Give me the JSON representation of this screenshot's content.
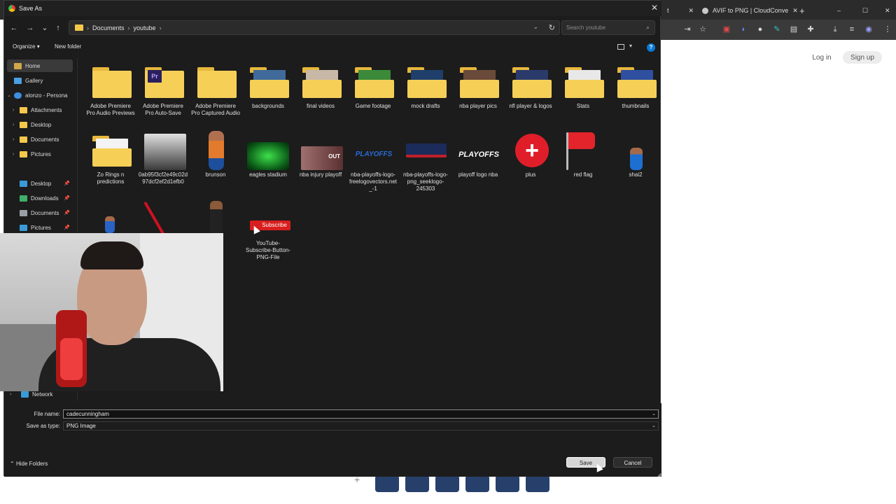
{
  "browser": {
    "tabs": [
      {
        "label": "t"
      },
      {
        "label": "AVIF to PNG | CloudConve"
      }
    ],
    "login": "Log in",
    "signup": "Sign up"
  },
  "dialog": {
    "title": "Save As",
    "breadcrumb": [
      "Documents",
      "youtube"
    ],
    "search_placeholder": "Search youtube",
    "organize": "Organize",
    "new_folder": "New folder",
    "sidebar": [
      {
        "label": "Home",
        "selected": true
      },
      {
        "label": "Gallery"
      },
      {
        "label": "alonzo - Persona"
      },
      {
        "label": "Attachments"
      },
      {
        "label": "Desktop"
      },
      {
        "label": "Documents"
      },
      {
        "label": "Pictures"
      },
      {
        "label": "Desktop",
        "pinned": true
      },
      {
        "label": "Downloads",
        "pinned": true
      },
      {
        "label": "Documents",
        "pinned": true
      },
      {
        "label": "Pictures",
        "pinned": true
      },
      {
        "label": "Network"
      }
    ],
    "items": [
      {
        "label": "Adobe Premiere Pro Audio Previews",
        "kind": "folder"
      },
      {
        "label": "Adobe Premiere Pro Auto-Save",
        "kind": "folder-pr"
      },
      {
        "label": "Adobe Premiere Pro Captured Audio",
        "kind": "folder"
      },
      {
        "label": "backgrounds",
        "kind": "folder-img"
      },
      {
        "label": "final videos",
        "kind": "folder-img"
      },
      {
        "label": "Game footage",
        "kind": "folder-img"
      },
      {
        "label": "mock drafts",
        "kind": "folder-img"
      },
      {
        "label": "nba player pics",
        "kind": "folder-img"
      },
      {
        "label": "nfl player & logos",
        "kind": "folder-img"
      },
      {
        "label": "Stats",
        "kind": "folder-img"
      },
      {
        "label": "thumbnails",
        "kind": "folder-img"
      },
      {
        "label": "Zo Rings n predictions",
        "kind": "folder"
      },
      {
        "label": "0ab95f3cf2e49c02d97dcf2ef2d1efb0",
        "kind": "image"
      },
      {
        "label": "brunson",
        "kind": "image"
      },
      {
        "label": "eagles stadium",
        "kind": "image"
      },
      {
        "label": "nba injury playoff",
        "kind": "image"
      },
      {
        "label": "nba-playoffs-logo-freelogovectors.net_-1",
        "kind": "image"
      },
      {
        "label": "nba-playoffs-logo-png_seeklogo-245303",
        "kind": "image"
      },
      {
        "label": "playoff logo nba",
        "kind": "image"
      },
      {
        "label": "plus",
        "kind": "image"
      },
      {
        "label": "red flag",
        "kind": "image"
      },
      {
        "label": "shai2",
        "kind": "image"
      },
      {
        "label": "",
        "kind": "image"
      },
      {
        "label": "",
        "kind": "image"
      },
      {
        "label": "",
        "kind": "image"
      },
      {
        "label": "YouTube-Subscribe-Button-PNG-File",
        "kind": "image"
      }
    ],
    "file_name_label": "File name:",
    "file_name_value": "cadecunningham",
    "save_type_label": "Save as type:",
    "save_type_value": "PNG Image",
    "hide_folders": "Hide Folders",
    "save": "Save",
    "cancel": "Cancel",
    "subscribe_text": "Subscribe",
    "logo_text": "PLAYOFFS",
    "out_text": "OUT"
  },
  "colors": {
    "accent": "#0a7ad6",
    "folder": "#f6cf57",
    "dialog_bg": "#1c1c1c"
  }
}
